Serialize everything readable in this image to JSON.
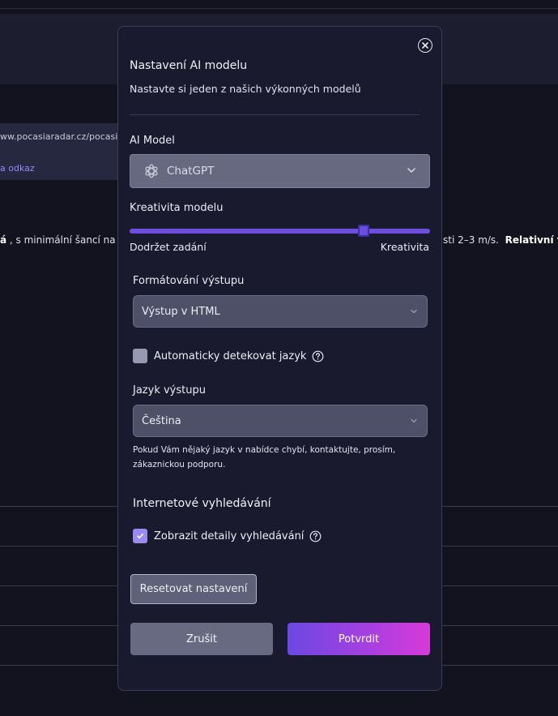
{
  "background": {
    "url_text": "ww.pocasiaradar.cz/pocasi/b",
    "link_text": "a odkaz",
    "text_left_bold": "á",
    "text_left": " , s minimální šancí na sr",
    "text_right": "sti 2–3 m/s.",
    "text_right_bold": "Relativní vl"
  },
  "modal": {
    "close_icon": "close-circle-icon",
    "title": "Nastavení AI modelu",
    "subtitle": "Nastavte si jeden z našich výkonných modelů",
    "model": {
      "label": "AI Model",
      "selected": "ChatGPT",
      "icon": "openai-logo-icon"
    },
    "creativity": {
      "label": "Kreativita modelu",
      "min_label": "Dodržet zadání",
      "max_label": "Kreativita",
      "value": 0.79
    },
    "formatting": {
      "label": "Formátování výstupu",
      "selected": "Výstup v HTML"
    },
    "auto_detect": {
      "label": "Automaticky detekovat jazyk",
      "checked": false
    },
    "language": {
      "label": "Jazyk výstupu",
      "selected": "Čeština",
      "hint": "Pokud Vám nějaký jazyk v nabídce chybí, kontaktujte, prosím, zákaznickou podporu."
    },
    "web_search": {
      "title": "Internetové vyhledávání",
      "details_label": "Zobrazit detaily vyhledávání",
      "checked": true
    },
    "reset_label": "Resetovat nastavení",
    "cancel_label": "Zrušit",
    "confirm_label": "Potvrdit"
  },
  "colors": {
    "accent": "#6d4fe0",
    "gradient_start": "#6c48e2",
    "gradient_end": "#d83ad9"
  }
}
